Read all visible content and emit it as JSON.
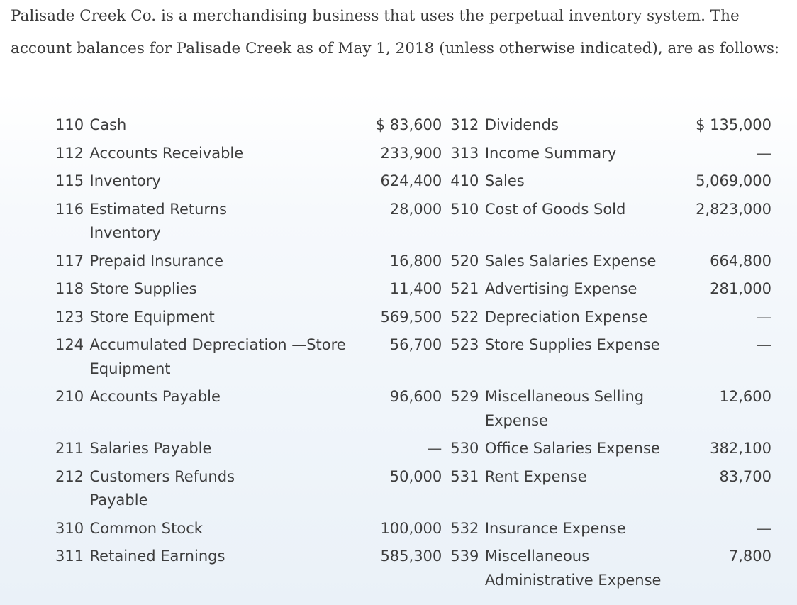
{
  "intro": "Palisade Creek Co. is a merchandising business that uses the perpetual inventory system. The account balances for Palisade Creek as of May 1, 2018 (unless otherwise indicated), are as follows:",
  "rows": [
    {
      "n1": "110",
      "a1": "Cash",
      "v1": "$ 83,600",
      "n2": "312",
      "a2": "Dividends",
      "v2": "$  135,000"
    },
    {
      "n1": "112",
      "a1": "Accounts Receivable",
      "v1": "233,900",
      "n2": "313",
      "a2": "Income Summary",
      "v2": "—"
    },
    {
      "n1": "115",
      "a1": "Inventory",
      "v1": "624,400",
      "n2": "410",
      "a2": "Sales",
      "v2": "5,069,000"
    },
    {
      "n1": "116",
      "a1": "Estimated Returns Inventory",
      "v1": "28,000",
      "n2": "510",
      "a2": "Cost of Goods Sold",
      "v2": "2,823,000"
    },
    {
      "n1": "117",
      "a1": "Prepaid Insurance",
      "v1": "16,800",
      "n2": "520",
      "a2": "Sales Salaries Expense",
      "v2": "664,800"
    },
    {
      "n1": "118",
      "a1": "Store Supplies",
      "v1": "11,400",
      "n2": "521",
      "a2": "Advertising Expense",
      "v2": "281,000"
    },
    {
      "n1": "123",
      "a1": "Store Equipment",
      "v1": "569,500",
      "n2": "522",
      "a2": "Depreciation Expense",
      "v2": "—"
    },
    {
      "n1": "124",
      "a1": "Accumulated Depreciation —Store Equipment",
      "v1": "56,700",
      "n2": "523",
      "a2": "Store Supplies Expense",
      "v2": "—"
    },
    {
      "n1": "210",
      "a1": "Accounts Payable",
      "v1": "96,600",
      "n2": "529",
      "a2": "Miscellaneous Selling Expense",
      "v2": "12,600"
    },
    {
      "n1": "211",
      "a1": "Salaries Payable",
      "v1": "—",
      "n2": "530",
      "a2": "Office Salaries Expense",
      "v2": "382,100"
    },
    {
      "n1": "212",
      "a1": "Customers Refunds Payable",
      "v1": "50,000",
      "n2": "531",
      "a2": "Rent Expense",
      "v2": "83,700"
    },
    {
      "n1": "310",
      "a1": "Common Stock",
      "v1": "100,000",
      "n2": "532",
      "a2": "Insurance Expense",
      "v2": "—"
    },
    {
      "n1": "311",
      "a1": "Retained Earnings",
      "v1": "585,300",
      "n2": "539",
      "a2": "Miscellaneous Administrative Expense",
      "v2": "7,800"
    }
  ]
}
